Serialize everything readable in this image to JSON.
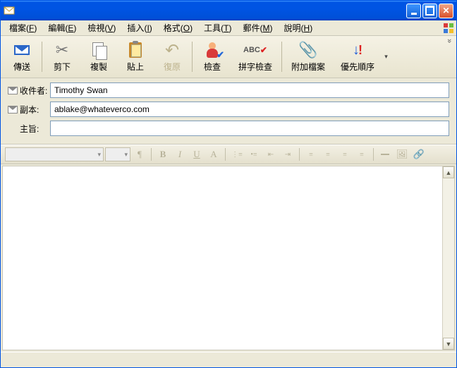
{
  "titlebar": {
    "title": ""
  },
  "menu": {
    "file": {
      "label": "檔案",
      "key": "F"
    },
    "edit": {
      "label": "編輯",
      "key": "E"
    },
    "view": {
      "label": "檢視",
      "key": "V"
    },
    "insert": {
      "label": "插入",
      "key": "I"
    },
    "format": {
      "label": "格式",
      "key": "O"
    },
    "tools": {
      "label": "工具",
      "key": "T"
    },
    "message": {
      "label": "郵件",
      "key": "M"
    },
    "help": {
      "label": "說明",
      "key": "H"
    }
  },
  "toolbar": {
    "send": "傳送",
    "cut": "剪下",
    "copy": "複製",
    "paste": "貼上",
    "undo": "復原",
    "check": "檢查",
    "spell": "拼字檢查",
    "attach": "附加檔案",
    "priority": "優先順序"
  },
  "fields": {
    "to_label": "收件者:",
    "cc_label": "副本:",
    "subject_label": "主旨:",
    "to_value": "Timothy Swan",
    "cc_value": "ablake@whateverco.com",
    "subject_value": ""
  },
  "format_toolbar": {
    "font": "",
    "size": "",
    "bold": "B",
    "italic": "I",
    "underline": "U",
    "color": "A"
  },
  "body": ""
}
